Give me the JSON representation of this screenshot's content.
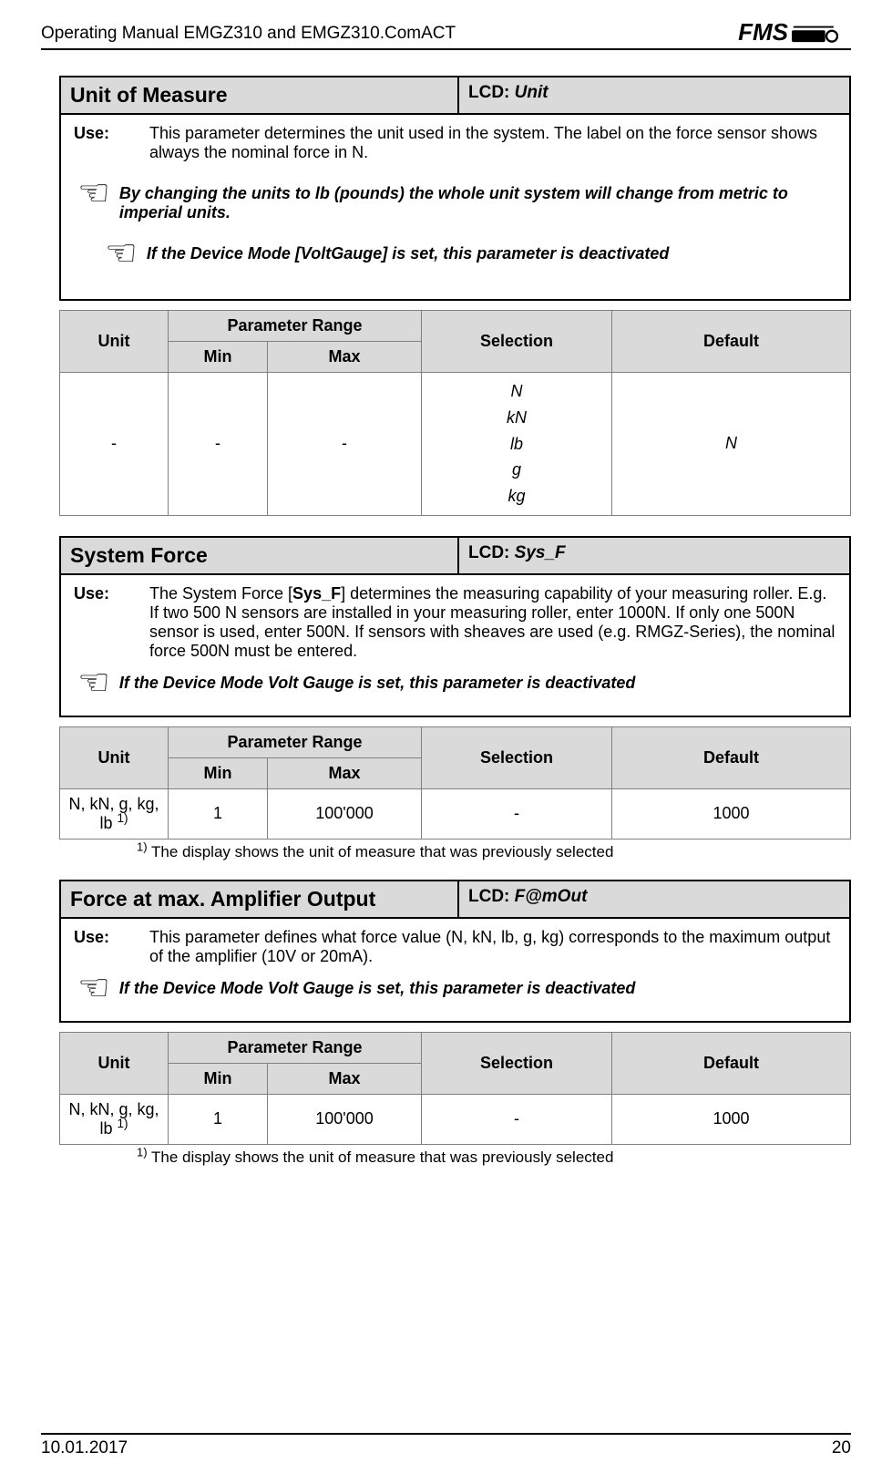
{
  "header": {
    "doc_title": "Operating Manual EMGZ310 and EMGZ310.ComACT",
    "logo_text": "FMS"
  },
  "footer": {
    "date": "10.01.2017",
    "page": "20"
  },
  "block1": {
    "title": "Unit of Measure",
    "lcd_label": "LCD: ",
    "lcd_value": "Unit",
    "use_label": "Use:",
    "use_text": "This parameter determines the unit used in the system. The label on the force sensor shows always the nominal force in N.",
    "note1": "By changing the units to lb (pounds) the whole unit system will   change from metric to imperial units.",
    "note2": "If the Device Mode [VoltGauge] is set, this parameter is deactivated",
    "table": {
      "h_unit": "Unit",
      "h_prange": "Parameter Range",
      "h_min": "Min",
      "h_max": "Max",
      "h_sel": "Selection",
      "h_def": "Default",
      "r_unit": "-",
      "r_min": "-",
      "r_max": "-",
      "r_sel1": "N",
      "r_sel2": "kN",
      "r_sel3": "lb",
      "r_sel4": "g",
      "r_sel5": "kg",
      "r_def": "N"
    }
  },
  "block2": {
    "title": "System Force",
    "lcd_label": "LCD: ",
    "lcd_value": "Sys_F",
    "use_label": "Use:",
    "use_text_pre": "The System Force [",
    "use_text_sysf": "Sys_F",
    "use_text_post": "] determines the measuring capability of your measuring roller. E.g. If two 500 N sensors are installed in your measuring roller, enter 1000N. If only one 500N sensor is used, enter 500N. If sensors with sheaves are used (e.g. RMGZ-Series), the nominal force 500N must be entered.",
    "note": "If the Device Mode Volt Gauge is set, this parameter is deactivated",
    "table": {
      "h_unit": "Unit",
      "h_prange": "Parameter Range",
      "h_min": "Min",
      "h_max": "Max",
      "h_sel": "Selection",
      "h_def": "Default",
      "r_unit": "N, kN, g, kg, lb ",
      "r_unit_sup": "1)",
      "r_min": "1",
      "r_max": "100'000",
      "r_sel": "-",
      "r_def": "1000"
    },
    "footnote_sup": "1)",
    "footnote": " The display shows the unit of measure that was previously selected"
  },
  "block3": {
    "title": "Force at max. Amplifier Output",
    "lcd_label": "LCD: ",
    "lcd_value": "F@mOut",
    "use_label": "Use:",
    "use_text": "This parameter defines what force value (N, kN, lb, g, kg) corresponds to the maximum output of the amplifier (10V or 20mA).",
    "note": "If the Device Mode  Volt Gauge is set, this parameter is deactivated",
    "table": {
      "h_unit": "Unit",
      "h_prange": "Parameter Range",
      "h_min": "Min",
      "h_max": "Max",
      "h_sel": "Selection",
      "h_def": "Default",
      "r_unit": "N, kN, g, kg, lb ",
      "r_unit_sup": "1)",
      "r_min": "1",
      "r_max": "100'000",
      "r_sel": "-",
      "r_def": "1000"
    },
    "footnote_sup": "1)",
    "footnote": " The display shows the unit of measure that was previously selected"
  }
}
